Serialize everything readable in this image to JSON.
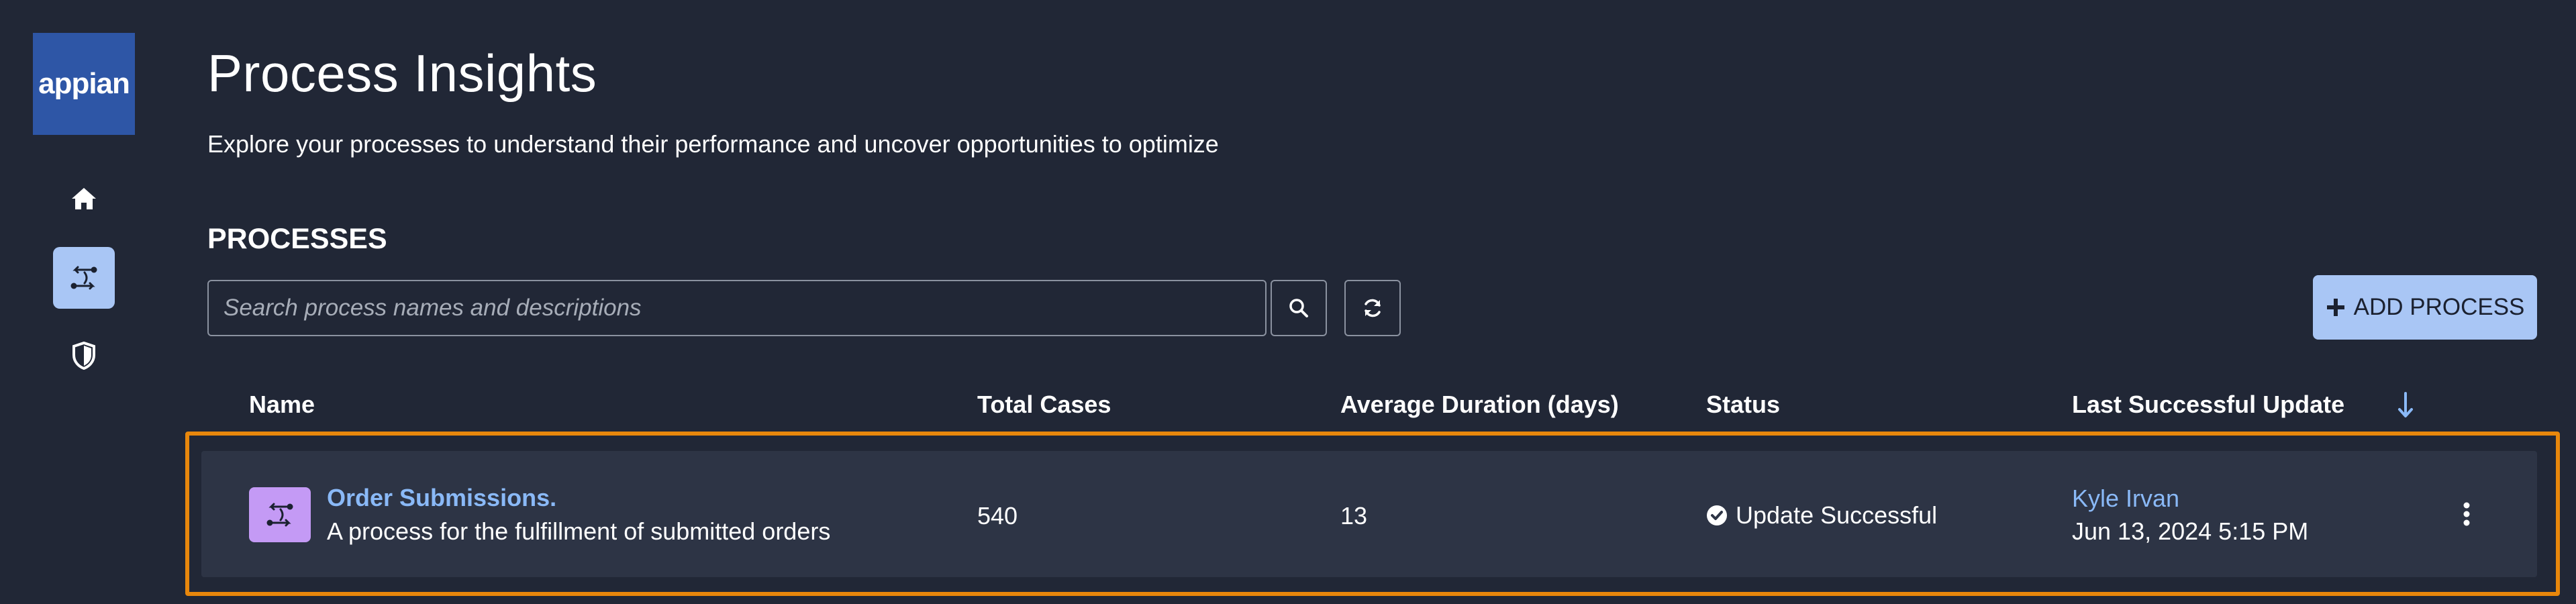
{
  "brand": {
    "logo_text": "appian",
    "logo_color": "#2e56a6"
  },
  "nav": {
    "items": [
      {
        "icon": "home-icon",
        "active": false
      },
      {
        "icon": "process-icon",
        "active": true
      },
      {
        "icon": "shield-icon",
        "active": false
      }
    ],
    "active_color": "#a9c6f5"
  },
  "header": {
    "title": "Process Insights",
    "subtitle": "Explore your processes to understand their performance and uncover opportunities to optimize"
  },
  "section": {
    "title": "PROCESSES"
  },
  "search": {
    "placeholder": "Search process names and descriptions",
    "value": ""
  },
  "toolbar": {
    "add_label": "ADD PROCESS",
    "add_icon": "plus-icon"
  },
  "table": {
    "columns": [
      "Name",
      "Total Cases",
      "Average Duration (days)",
      "Status",
      "Last Successful Update"
    ],
    "sort": {
      "column": "Last Successful Update",
      "direction": "descending"
    },
    "rows": [
      {
        "name": "Order Submissions.",
        "description": "A process for the fulfillment of submitted orders",
        "total_cases": "540",
        "average_duration": "13",
        "status": "Update Successful",
        "updated_by": "Kyle Irvan",
        "updated_at": "Jun 13, 2024 5:15 PM"
      }
    ]
  },
  "colors": {
    "background": "#212736",
    "row_background": "#2d3445",
    "highlight_border": "#e8870c",
    "link": "#8ab9f7",
    "process_icon_bg": "#c49af5"
  }
}
